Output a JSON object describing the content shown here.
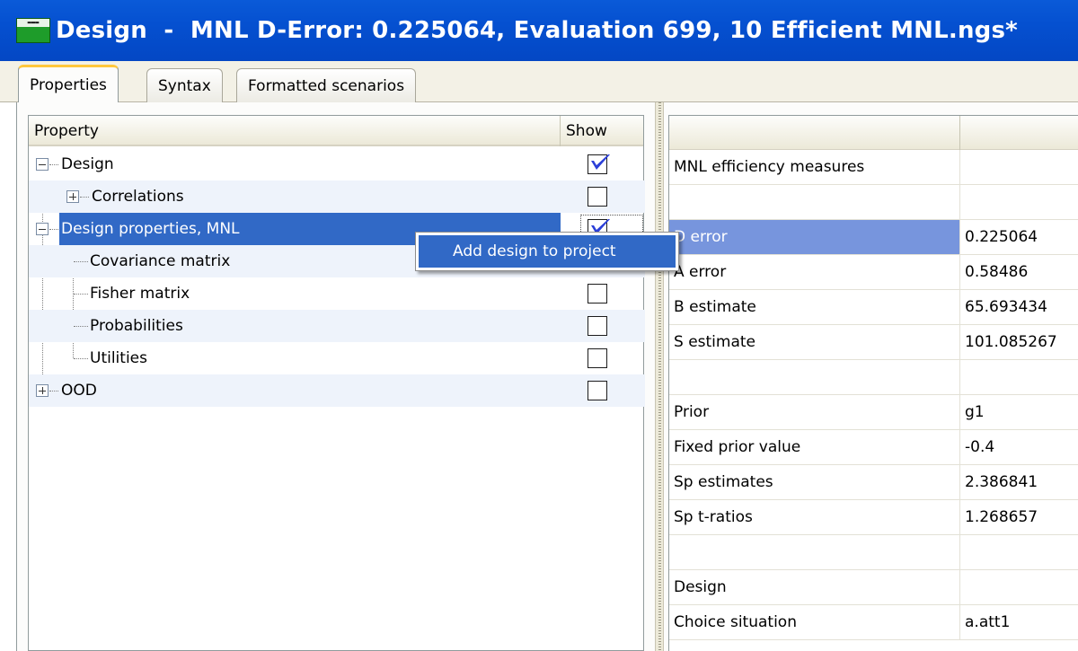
{
  "window": {
    "title": "Design  -  MNL D-Error: 0.225064, Evaluation 699, 10 Efficient MNL.ngs*",
    "icon": "ngene-app-icon"
  },
  "tabs": [
    {
      "label": "Properties",
      "active": true
    },
    {
      "label": "Syntax",
      "active": false
    },
    {
      "label": "Formatted scenarios",
      "active": false
    }
  ],
  "tree": {
    "columns": {
      "property": "Property",
      "show": "Show"
    },
    "rows": [
      {
        "label": "Design",
        "show": true,
        "expander": "minus"
      },
      {
        "label": "Correlations",
        "show": false,
        "expander": "plus"
      },
      {
        "label": "Design properties, MNL",
        "show": true,
        "expander": "minus",
        "selected": true
      },
      {
        "label": "Covariance matrix",
        "show": false
      },
      {
        "label": "Fisher matrix",
        "show": false
      },
      {
        "label": "Probabilities",
        "show": false
      },
      {
        "label": "Utilities",
        "show": false
      },
      {
        "label": "OOD",
        "show": false,
        "expander": "plus"
      }
    ]
  },
  "context_menu": {
    "items": [
      {
        "label": "Add design to project"
      }
    ]
  },
  "results": {
    "columns": [
      "",
      ""
    ],
    "rows": [
      {
        "label": "MNL efficiency measures",
        "value": ""
      },
      {
        "label": "",
        "value": ""
      },
      {
        "label": "D error",
        "value": "0.225064"
      },
      {
        "label": "A error",
        "value": "0.58486"
      },
      {
        "label": "B estimate",
        "value": "65.693434"
      },
      {
        "label": "S estimate",
        "value": "101.085267"
      },
      {
        "label": "",
        "value": ""
      },
      {
        "label": "Prior",
        "value": "g1"
      },
      {
        "label": "Fixed prior value",
        "value": "-0.4"
      },
      {
        "label": "Sp estimates",
        "value": "2.386841"
      },
      {
        "label": "Sp t-ratios",
        "value": "1.268657"
      },
      {
        "label": "",
        "value": ""
      },
      {
        "label": "Design",
        "value": ""
      },
      {
        "label": "Choice situation",
        "value": "a.att1"
      }
    ]
  },
  "colors": {
    "titlebar": "#0550d0",
    "selection": "#3169c6",
    "active_tab_accent": "#ffc73c",
    "checkmark": "#2b3fd8"
  }
}
